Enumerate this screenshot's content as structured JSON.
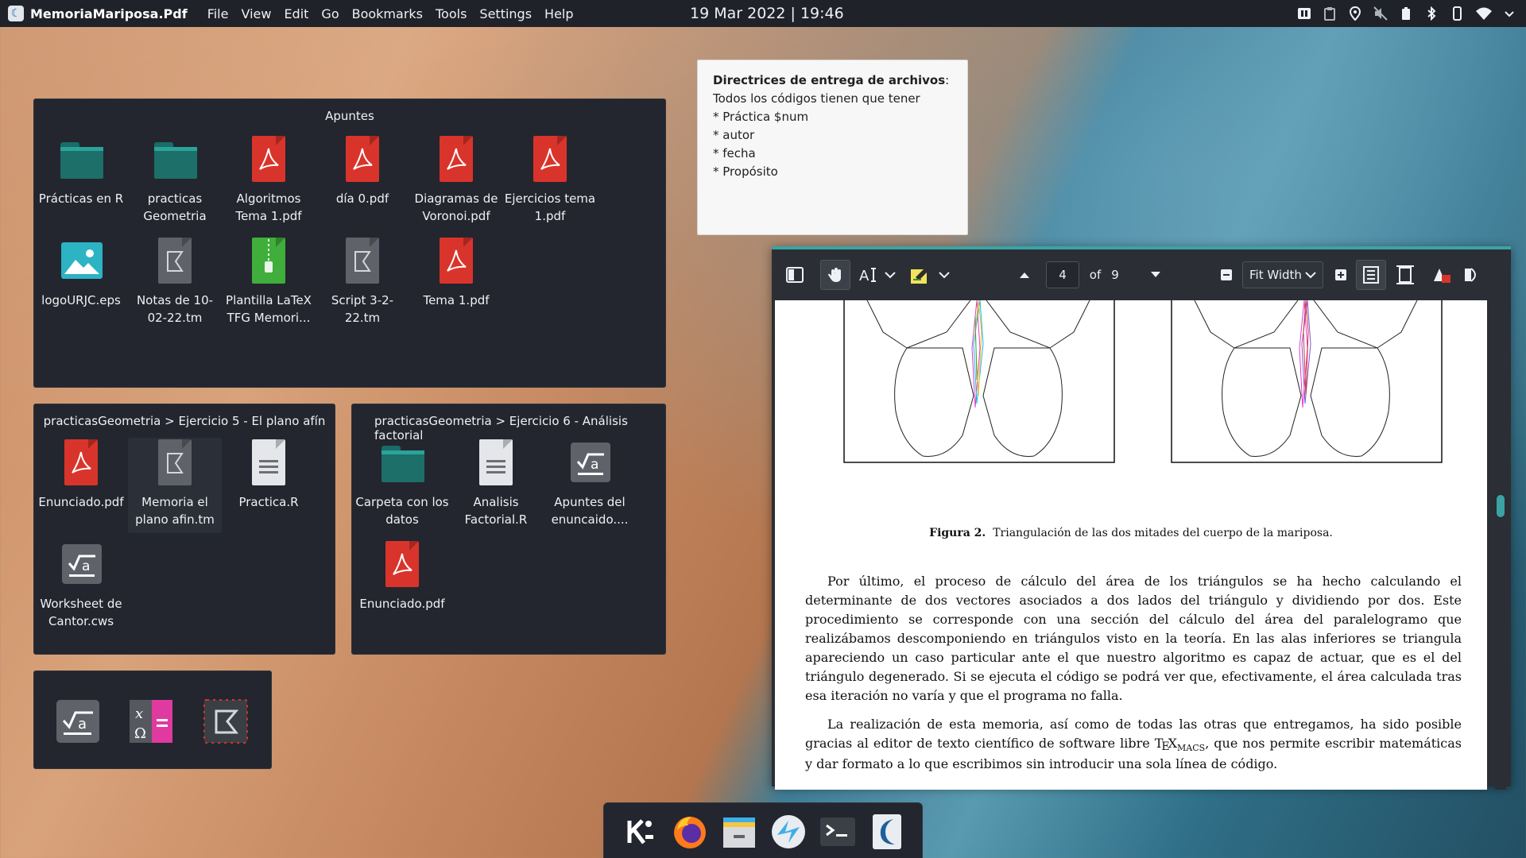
{
  "topbar": {
    "app_title": "MemoriaMariposa.Pdf",
    "menu": [
      "File",
      "View",
      "Edit",
      "Go",
      "Bookmarks",
      "Tools",
      "Settings",
      "Help"
    ],
    "clock": "19 Mar 2022 | 19:46"
  },
  "apuntes": {
    "title": "Apuntes",
    "items": [
      {
        "label": "Prácticas en R",
        "icon": "folder-icon"
      },
      {
        "label": "practicas Geometria",
        "icon": "folder-icon"
      },
      {
        "label": "Algoritmos Tema 1.pdf",
        "icon": "pdf-icon"
      },
      {
        "label": "día 0.pdf",
        "icon": "pdf-icon"
      },
      {
        "label": "Diagramas de Voronoi.pdf",
        "icon": "pdf-icon"
      },
      {
        "label": "Ejercicios tema 1.pdf",
        "icon": "pdf-icon"
      },
      {
        "label": "logoURJC.eps",
        "icon": "image-icon"
      },
      {
        "label": "Notas de 10-02-22.tm",
        "icon": "texmacs-icon"
      },
      {
        "label": "Plantilla LaTeX TFG Memori...",
        "icon": "archive-icon"
      },
      {
        "label": "Script 3-2-22.tm",
        "icon": "texmacs-icon"
      },
      {
        "label": "Tema 1.pdf",
        "icon": "pdf-icon"
      }
    ]
  },
  "ej5": {
    "title": "practicasGeometria > Ejercicio 5 - El plano afín",
    "items": [
      {
        "label": "Enunciado.pdf",
        "icon": "pdf-icon"
      },
      {
        "label": "Memoria el plano afin.tm",
        "icon": "texmacs-icon"
      },
      {
        "label": "Practica.R",
        "icon": "text-file-icon"
      },
      {
        "label": "Worksheet de Cantor.cws",
        "icon": "cantor-icon"
      }
    ]
  },
  "ej6": {
    "title": "practicasGeometria > Ejercicio 6 - Análisis factorial",
    "items": [
      {
        "label": "Carpeta con los datos",
        "icon": "folder-icon"
      },
      {
        "label": "Analisis Factorial.R",
        "icon": "text-file-icon"
      },
      {
        "label": "Apuntes del enuncaido....",
        "icon": "cantor-icon"
      },
      {
        "label": "Enunciado.pdf",
        "icon": "pdf-icon"
      }
    ]
  },
  "note": {
    "heading": "Directrices de entrega de archivos",
    "colon": ":",
    "lines": [
      "Todos los códigos tienen que tener",
      "* Práctica $num",
      "* autor",
      "* fecha",
      "* Propósito"
    ]
  },
  "okular": {
    "page_current": "4",
    "page_of": "of",
    "page_total": "9",
    "zoom": "Fit Width",
    "caption_label": "Figura 2.",
    "caption_text": "Triangulación de las dos mitades del cuerpo de la mariposa.",
    "para1": "Por último, el proceso de cálculo del área de los triángulos se ha hecho calculando el determinante de dos vectores asociados a dos lados del triángulo y dividiendo por dos. Este procedimiento se corresponde con una sección del cálculo del área del paralelogramo que realizábamos descomponiendo en triángulos visto en la teoría. En las alas inferiores se triangula apareciendo un caso particular ante el que nuestro algoritmo es capaz de actuar, que es el del triángulo degenerado. Si se ejecuta el código se podrá ver que, efectivamente, el área calculada tras esa iteración no varía y que el programa no falla.",
    "para2_a": "La realización de esta memoria, así como de todas las otras que entregamos, ha sido posible gracias al editor de texto científico de software libre ",
    "tex_T": "T",
    "tex_E": "E",
    "tex_X": "X",
    "tex_macs": "MACS",
    "para2_b": ", que nos permite escribir matemáticas y dar formato a lo que escribimos sin introducir una sola línea de código."
  },
  "dock": {
    "apps": [
      "kde-menu-icon",
      "firefox-icon",
      "file-manager-icon",
      "discover-icon",
      "terminal-icon",
      "okular-icon"
    ]
  },
  "colors": {
    "accent": "#3ba3a3",
    "pdf": "#d9342b",
    "folder": "#1d6f69",
    "panel": "#23262e"
  }
}
